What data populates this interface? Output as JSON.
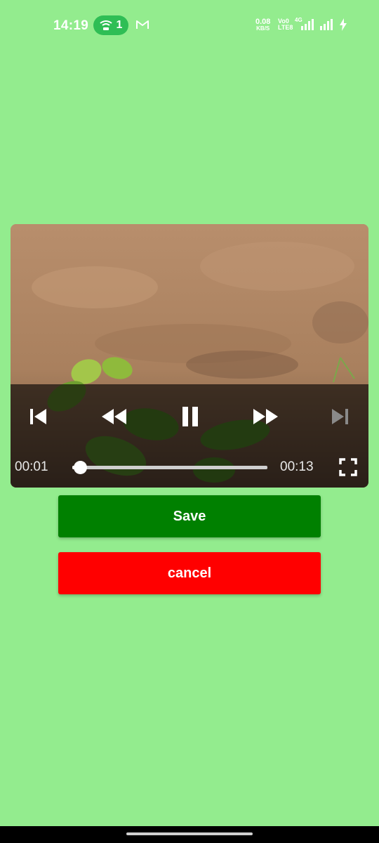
{
  "status_bar": {
    "time": "14:19",
    "hotspot_count": "1",
    "net_speed_value": "0.08",
    "net_speed_unit": "KB/S",
    "volte_top": "Vo0",
    "volte_bottom": "LTE8",
    "network_type": "4G",
    "icons": [
      "wifi-hotspot-icon",
      "gmail-icon",
      "signal-icon",
      "signal-icon",
      "charging-bolt-icon"
    ]
  },
  "player": {
    "current_time": "00:01",
    "duration": "00:13",
    "progress_fraction": 0.04,
    "controls": [
      "skip-previous-icon",
      "rewind-icon",
      "pause-icon",
      "fast-forward-icon",
      "skip-next-icon",
      "fullscreen-icon"
    ]
  },
  "actions": {
    "save_label": "Save",
    "cancel_label": "cancel"
  },
  "colors": {
    "background": "#93ec8e",
    "save": "#008000",
    "cancel": "#ff0000",
    "hotspot_pill": "#2fbe55"
  }
}
